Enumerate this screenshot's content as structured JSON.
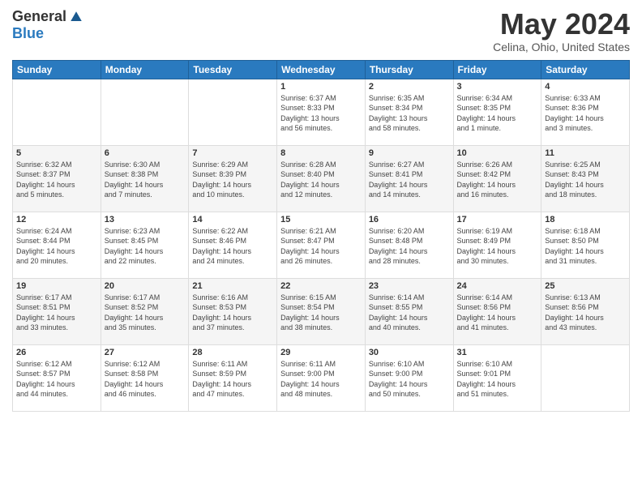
{
  "logo": {
    "general": "General",
    "blue": "Blue"
  },
  "title": "May 2024",
  "location": "Celina, Ohio, United States",
  "headers": [
    "Sunday",
    "Monday",
    "Tuesday",
    "Wednesday",
    "Thursday",
    "Friday",
    "Saturday"
  ],
  "weeks": [
    [
      {
        "day": "",
        "info": ""
      },
      {
        "day": "",
        "info": ""
      },
      {
        "day": "",
        "info": ""
      },
      {
        "day": "1",
        "info": "Sunrise: 6:37 AM\nSunset: 8:33 PM\nDaylight: 13 hours\nand 56 minutes."
      },
      {
        "day": "2",
        "info": "Sunrise: 6:35 AM\nSunset: 8:34 PM\nDaylight: 13 hours\nand 58 minutes."
      },
      {
        "day": "3",
        "info": "Sunrise: 6:34 AM\nSunset: 8:35 PM\nDaylight: 14 hours\nand 1 minute."
      },
      {
        "day": "4",
        "info": "Sunrise: 6:33 AM\nSunset: 8:36 PM\nDaylight: 14 hours\nand 3 minutes."
      }
    ],
    [
      {
        "day": "5",
        "info": "Sunrise: 6:32 AM\nSunset: 8:37 PM\nDaylight: 14 hours\nand 5 minutes."
      },
      {
        "day": "6",
        "info": "Sunrise: 6:30 AM\nSunset: 8:38 PM\nDaylight: 14 hours\nand 7 minutes."
      },
      {
        "day": "7",
        "info": "Sunrise: 6:29 AM\nSunset: 8:39 PM\nDaylight: 14 hours\nand 10 minutes."
      },
      {
        "day": "8",
        "info": "Sunrise: 6:28 AM\nSunset: 8:40 PM\nDaylight: 14 hours\nand 12 minutes."
      },
      {
        "day": "9",
        "info": "Sunrise: 6:27 AM\nSunset: 8:41 PM\nDaylight: 14 hours\nand 14 minutes."
      },
      {
        "day": "10",
        "info": "Sunrise: 6:26 AM\nSunset: 8:42 PM\nDaylight: 14 hours\nand 16 minutes."
      },
      {
        "day": "11",
        "info": "Sunrise: 6:25 AM\nSunset: 8:43 PM\nDaylight: 14 hours\nand 18 minutes."
      }
    ],
    [
      {
        "day": "12",
        "info": "Sunrise: 6:24 AM\nSunset: 8:44 PM\nDaylight: 14 hours\nand 20 minutes."
      },
      {
        "day": "13",
        "info": "Sunrise: 6:23 AM\nSunset: 8:45 PM\nDaylight: 14 hours\nand 22 minutes."
      },
      {
        "day": "14",
        "info": "Sunrise: 6:22 AM\nSunset: 8:46 PM\nDaylight: 14 hours\nand 24 minutes."
      },
      {
        "day": "15",
        "info": "Sunrise: 6:21 AM\nSunset: 8:47 PM\nDaylight: 14 hours\nand 26 minutes."
      },
      {
        "day": "16",
        "info": "Sunrise: 6:20 AM\nSunset: 8:48 PM\nDaylight: 14 hours\nand 28 minutes."
      },
      {
        "day": "17",
        "info": "Sunrise: 6:19 AM\nSunset: 8:49 PM\nDaylight: 14 hours\nand 30 minutes."
      },
      {
        "day": "18",
        "info": "Sunrise: 6:18 AM\nSunset: 8:50 PM\nDaylight: 14 hours\nand 31 minutes."
      }
    ],
    [
      {
        "day": "19",
        "info": "Sunrise: 6:17 AM\nSunset: 8:51 PM\nDaylight: 14 hours\nand 33 minutes."
      },
      {
        "day": "20",
        "info": "Sunrise: 6:17 AM\nSunset: 8:52 PM\nDaylight: 14 hours\nand 35 minutes."
      },
      {
        "day": "21",
        "info": "Sunrise: 6:16 AM\nSunset: 8:53 PM\nDaylight: 14 hours\nand 37 minutes."
      },
      {
        "day": "22",
        "info": "Sunrise: 6:15 AM\nSunset: 8:54 PM\nDaylight: 14 hours\nand 38 minutes."
      },
      {
        "day": "23",
        "info": "Sunrise: 6:14 AM\nSunset: 8:55 PM\nDaylight: 14 hours\nand 40 minutes."
      },
      {
        "day": "24",
        "info": "Sunrise: 6:14 AM\nSunset: 8:56 PM\nDaylight: 14 hours\nand 41 minutes."
      },
      {
        "day": "25",
        "info": "Sunrise: 6:13 AM\nSunset: 8:56 PM\nDaylight: 14 hours\nand 43 minutes."
      }
    ],
    [
      {
        "day": "26",
        "info": "Sunrise: 6:12 AM\nSunset: 8:57 PM\nDaylight: 14 hours\nand 44 minutes."
      },
      {
        "day": "27",
        "info": "Sunrise: 6:12 AM\nSunset: 8:58 PM\nDaylight: 14 hours\nand 46 minutes."
      },
      {
        "day": "28",
        "info": "Sunrise: 6:11 AM\nSunset: 8:59 PM\nDaylight: 14 hours\nand 47 minutes."
      },
      {
        "day": "29",
        "info": "Sunrise: 6:11 AM\nSunset: 9:00 PM\nDaylight: 14 hours\nand 48 minutes."
      },
      {
        "day": "30",
        "info": "Sunrise: 6:10 AM\nSunset: 9:00 PM\nDaylight: 14 hours\nand 50 minutes."
      },
      {
        "day": "31",
        "info": "Sunrise: 6:10 AM\nSunset: 9:01 PM\nDaylight: 14 hours\nand 51 minutes."
      },
      {
        "day": "",
        "info": ""
      }
    ]
  ]
}
